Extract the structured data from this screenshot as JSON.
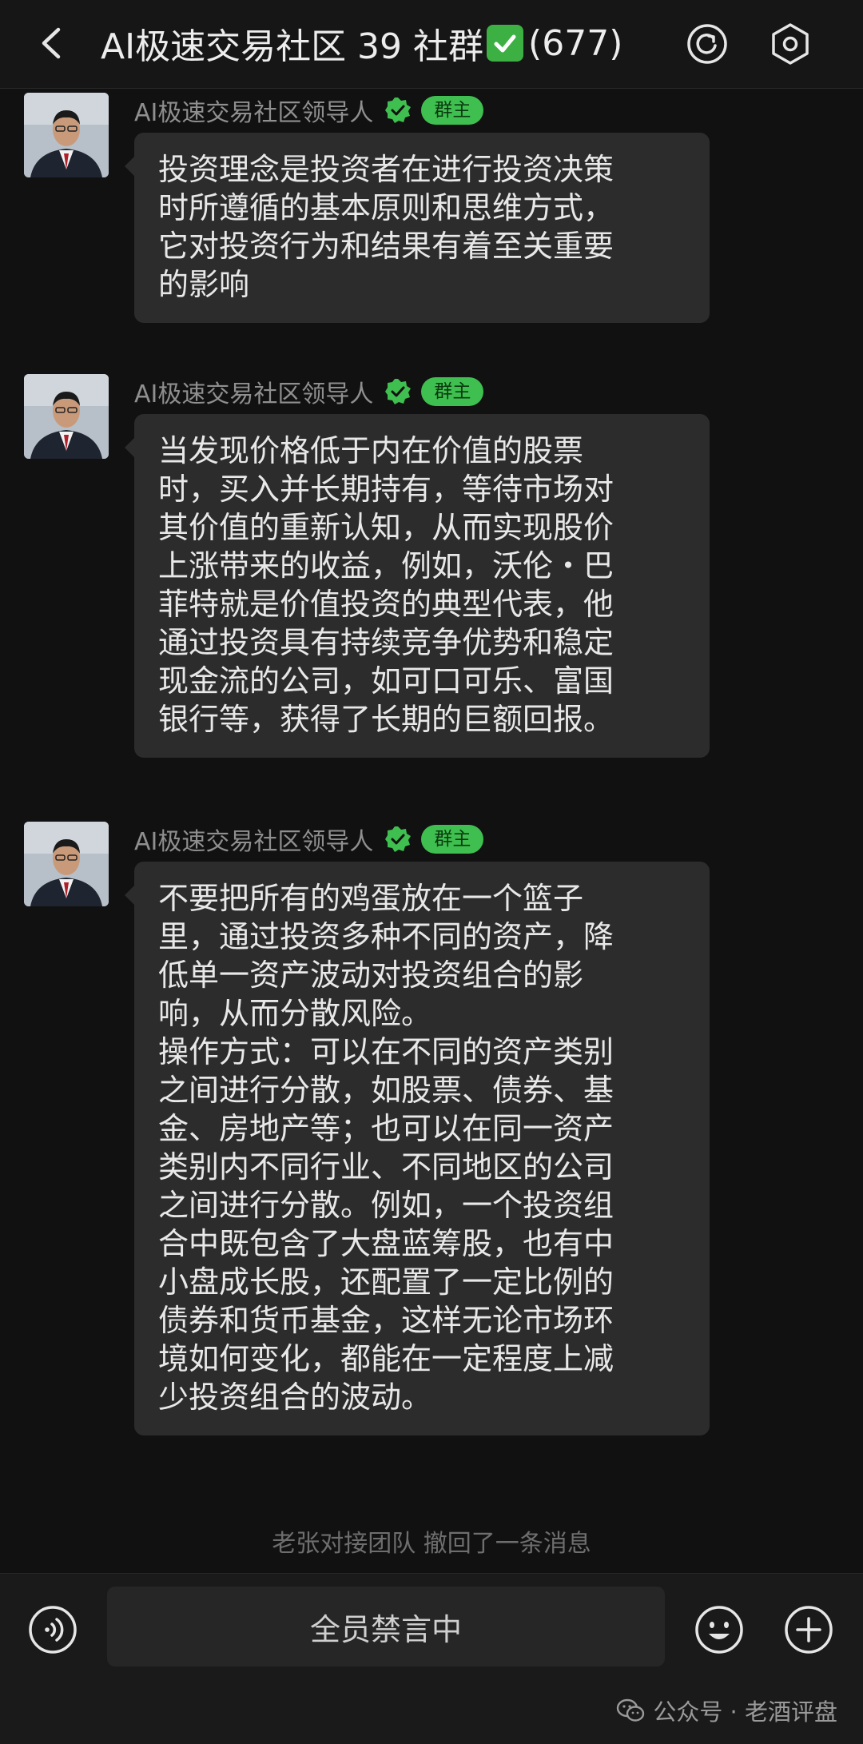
{
  "header": {
    "title": "AI极速交易社区 39 社群",
    "title_emoji": "check-mark-button",
    "member_count": "(677)",
    "back_icon": "chevron-left-icon",
    "icons": [
      "circular-arrow-icon",
      "hexagon-settings-icon"
    ]
  },
  "messages": [
    {
      "sender": "AI极速交易社区领导人",
      "role": "群主",
      "text": "投资理念是投资者在进行投资决策\n时所遵循的基本原则和思维方式，\n它对投资行为和结果有着至关重要\n的影响"
    },
    {
      "sender": "AI极速交易社区领导人",
      "role": "群主",
      "text": "当发现价格低于内在价值的股票\n时，买入并长期持有，等待市场对\n其价值的重新认知，从而实现股价\n上涨带来的收益，例如，沃伦・巴\n菲特就是价值投资的典型代表，他\n通过投资具有持续竞争优势和稳定\n现金流的公司，如可口可乐、富国\n银行等，获得了长期的巨额回报。"
    },
    {
      "sender": "AI极速交易社区领导人",
      "role": "群主",
      "text": "不要把所有的鸡蛋放在一个篮子\n里，通过投资多种不同的资产，降\n低单一资产波动对投资组合的影\n响，从而分散风险。\n操作方式：可以在不同的资产类别\n之间进行分散，如股票、债券、基\n金、房地产等；也可以在同一资产\n类别内不同行业、不同地区的公司\n之间进行分散。例如，一个投资组\n合中既包含了大盘蓝筹股，也有中\n小盘成长股，还配置了一定比例的\n债券和货币基金，这样无论市场环\n境如何变化，都能在一定程度上减\n少投资组合的波动。"
    }
  ],
  "system_notice": "老张对接团队 撤回了一条消息",
  "input_bar": {
    "muted_text": "全员禁言中",
    "left_icon": "voice-icon",
    "right_icons": [
      "emoji-icon",
      "plus-icon"
    ]
  },
  "watermark": "公众号 · 老酒评盘",
  "colors": {
    "background": "#111111",
    "bubble": "#2c2c2c",
    "badge": "#3fbf4f",
    "verified": "#3fbf4f"
  }
}
